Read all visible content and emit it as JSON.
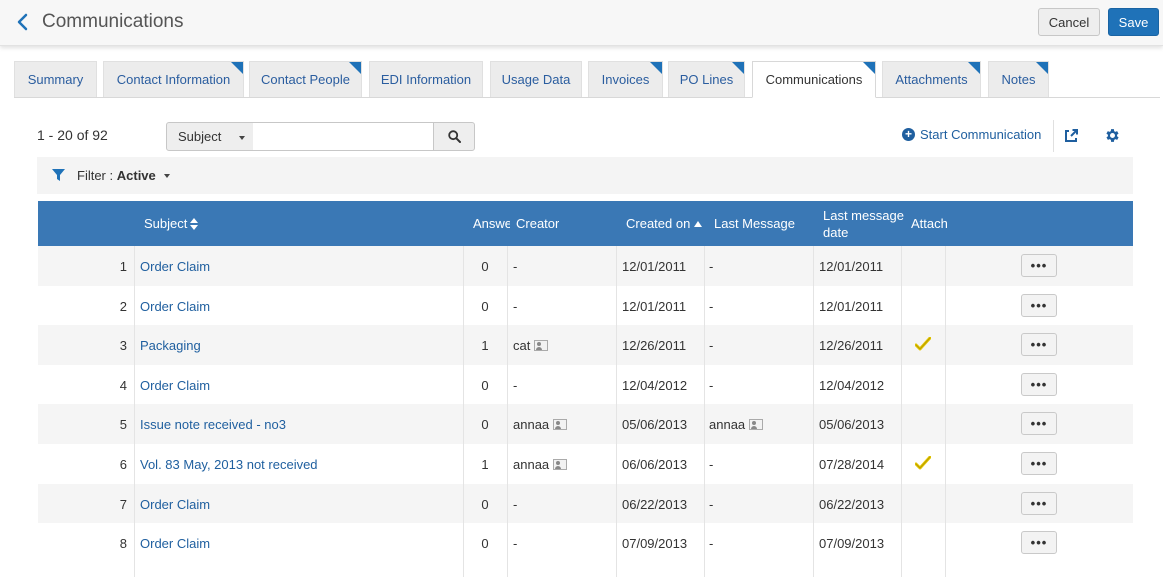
{
  "header": {
    "title": "Communications",
    "cancel_label": "Cancel",
    "save_label": "Save"
  },
  "tabs": [
    {
      "label": "Summary",
      "marked": false,
      "active": false
    },
    {
      "label": "Contact Information",
      "marked": true,
      "active": false
    },
    {
      "label": "Contact People",
      "marked": true,
      "active": false
    },
    {
      "label": "EDI Information",
      "marked": false,
      "active": false
    },
    {
      "label": "Usage Data",
      "marked": false,
      "active": false
    },
    {
      "label": "Invoices",
      "marked": true,
      "active": false
    },
    {
      "label": "PO Lines",
      "marked": true,
      "active": false
    },
    {
      "label": "Communications",
      "marked": true,
      "active": true
    },
    {
      "label": "Attachments",
      "marked": true,
      "active": false
    },
    {
      "label": "Notes",
      "marked": true,
      "active": false
    }
  ],
  "toolbar": {
    "count": "1 - 20 of 92",
    "search_field": "Subject",
    "search_value": "",
    "start_communication": "Start Communication"
  },
  "filter": {
    "label": "Filter :",
    "value": "Active"
  },
  "table": {
    "headers": {
      "subject": "Subject",
      "answers": "Answe",
      "creator": "Creator",
      "created_on": "Created on",
      "last_message": "Last Message",
      "last_message_date": "Last message date",
      "attach": "Attach"
    },
    "sort": {
      "subject": "both",
      "created_on": "asc"
    },
    "rows": [
      {
        "num": "1",
        "subject": "Order Claim",
        "answers": "0",
        "creator": "-",
        "creator_icon": false,
        "created_on": "12/01/2011",
        "last_message": "-",
        "last_message_icon": false,
        "last_message_date": "12/01/2011",
        "attach": false
      },
      {
        "num": "2",
        "subject": "Order Claim",
        "answers": "0",
        "creator": "-",
        "creator_icon": false,
        "created_on": "12/01/2011",
        "last_message": "-",
        "last_message_icon": false,
        "last_message_date": "12/01/2011",
        "attach": false
      },
      {
        "num": "3",
        "subject": "Packaging",
        "answers": "1",
        "creator": "cat",
        "creator_icon": true,
        "created_on": "12/26/2011",
        "last_message": "-",
        "last_message_icon": false,
        "last_message_date": "12/26/2011",
        "attach": true
      },
      {
        "num": "4",
        "subject": "Order Claim",
        "answers": "0",
        "creator": "-",
        "creator_icon": false,
        "created_on": "12/04/2012",
        "last_message": "-",
        "last_message_icon": false,
        "last_message_date": "12/04/2012",
        "attach": false
      },
      {
        "num": "5",
        "subject": "Issue note received - no3",
        "answers": "0",
        "creator": "annaa",
        "creator_icon": true,
        "created_on": "05/06/2013",
        "last_message": "annaa",
        "last_message_icon": true,
        "last_message_date": "05/06/2013",
        "attach": false
      },
      {
        "num": "6",
        "subject": "Vol. 83 May, 2013 not received",
        "answers": "1",
        "creator": "annaa",
        "creator_icon": true,
        "created_on": "06/06/2013",
        "last_message": "-",
        "last_message_icon": false,
        "last_message_date": "07/28/2014",
        "attach": true
      },
      {
        "num": "7",
        "subject": "Order Claim",
        "answers": "0",
        "creator": "-",
        "creator_icon": false,
        "created_on": "06/22/2013",
        "last_message": "-",
        "last_message_icon": false,
        "last_message_date": "06/22/2013",
        "attach": false
      },
      {
        "num": "8",
        "subject": "Order Claim",
        "answers": "0",
        "creator": "-",
        "creator_icon": false,
        "created_on": "07/09/2013",
        "last_message": "-",
        "last_message_icon": false,
        "last_message_date": "07/09/2013",
        "attach": false
      }
    ],
    "more_label": "•••"
  },
  "icons": {
    "back": "chevron-left-icon",
    "search": "search-icon",
    "start": "plus-circle-icon",
    "export": "export-icon",
    "settings": "gear-icon",
    "filter": "funnel-icon",
    "attachment": "check-icon",
    "user": "user-card-icon"
  },
  "colors": {
    "primary": "#1f72b8",
    "link": "#1f5f9f",
    "table_header": "#3a78b5",
    "tab_marker": "#1f72b8",
    "check": "#e6c800"
  }
}
